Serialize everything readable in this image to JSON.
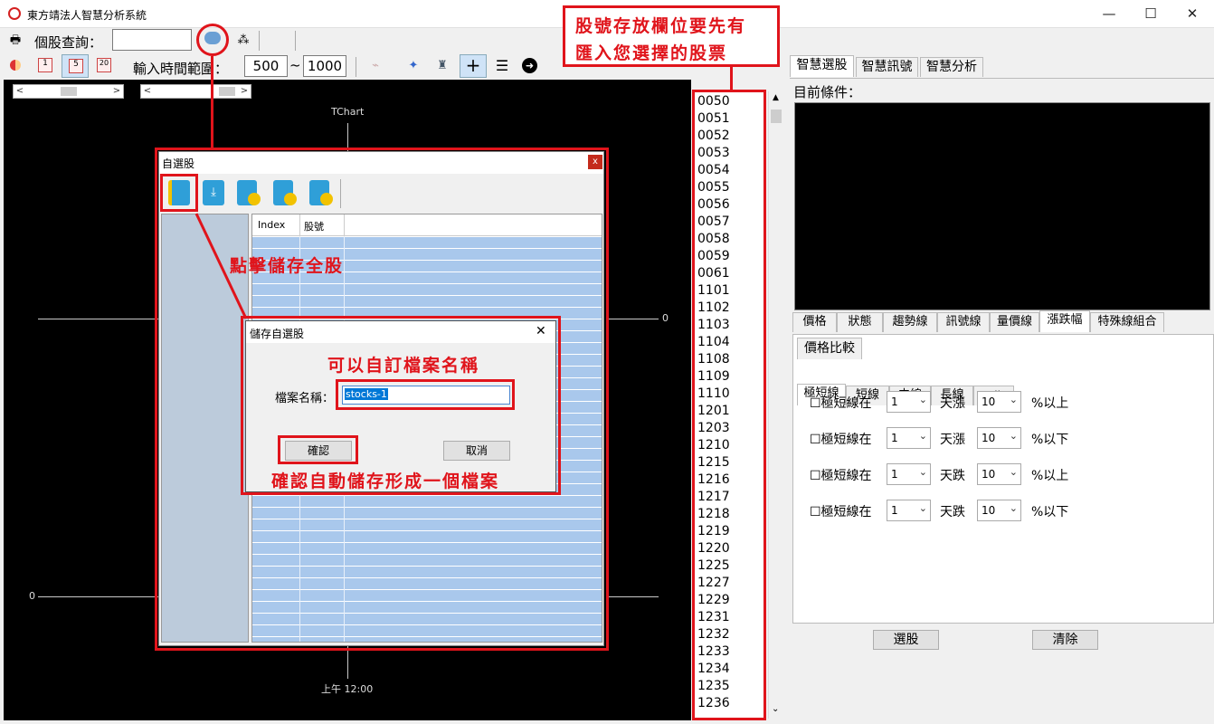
{
  "window": {
    "title": "東方靖法人智慧分析系統",
    "min": "—",
    "max": "☐",
    "close": "✕"
  },
  "toolbar": {
    "query_label": "個股查詢：",
    "range_label": "輸入時間範圍：",
    "range_from": "500",
    "range_sep": "~",
    "range_to": "1000",
    "small_icons": [
      "20"
    ]
  },
  "chart": {
    "title": "TChart",
    "zero_left": "0",
    "zero_right": "0",
    "time_label": "上午 12:00"
  },
  "dialog_watchlist": {
    "title": "自選股",
    "close": "x",
    "col_index": "Index",
    "col_stock": "股號"
  },
  "dialog_save": {
    "title": "儲存自選股",
    "close": "✕",
    "file_label": "檔案名稱：",
    "file_value": "stocks-1",
    "ok": "確認",
    "cancel": "取消"
  },
  "annotations": {
    "top_note_1": "股號存放欄位要先有",
    "top_note_2": "匯入您選擇的股票",
    "click_save_all": "點擊儲存全股",
    "custom_name": "可以自訂檔案名稱",
    "confirm_note": "確認自動儲存形成一個檔案"
  },
  "stock_list": [
    "0050",
    "0051",
    "0052",
    "0053",
    "0054",
    "0055",
    "0056",
    "0057",
    "0058",
    "0059",
    "0061",
    "1101",
    "1102",
    "1103",
    "1104",
    "1108",
    "1109",
    "1110",
    "1201",
    "1203",
    "1210",
    "1215",
    "1216",
    "1217",
    "1218",
    "1219",
    "1220",
    "1225",
    "1227",
    "1229",
    "1231",
    "1232",
    "1233",
    "1234",
    "1235",
    "1236"
  ],
  "right_panel": {
    "tabs": [
      "智慧選股",
      "智慧訊號",
      "智慧分析"
    ],
    "condition_label": "目前條件：",
    "sub_tabs": [
      "價格",
      "狀態",
      "趨勢線",
      "訊號線",
      "量價線",
      "漲跌幅",
      "特殊線組合"
    ],
    "price_compare": "價格比較",
    "line_tabs": [
      "極短線",
      "短線",
      "中線",
      "長線",
      "All"
    ],
    "conditions": [
      {
        "label": "☐極短線在",
        "days": "1",
        "dir": "天漲",
        "pct": "10",
        "tail": "%以上"
      },
      {
        "label": "☐極短線在",
        "days": "1",
        "dir": "天漲",
        "pct": "10",
        "tail": "%以下"
      },
      {
        "label": "☐極短線在",
        "days": "1",
        "dir": "天跌",
        "pct": "10",
        "tail": "%以上"
      },
      {
        "label": "☐極短線在",
        "days": "1",
        "dir": "天跌",
        "pct": "10",
        "tail": "%以下"
      }
    ],
    "select_button": "選股",
    "clear_button": "清除"
  },
  "colors": {
    "annotation_red": "#e0141b",
    "grid_blue": "#a9c8ec",
    "chart_bg": "#000000"
  }
}
